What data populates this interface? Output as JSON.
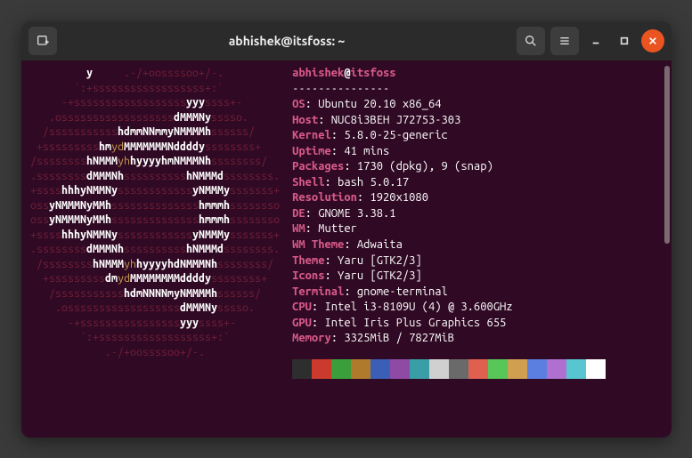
{
  "title": "abhishek@itsfoss: ~",
  "userhost": {
    "user": "abhishek",
    "at": "@",
    "host": "itsfoss"
  },
  "dashes": "---------------",
  "info": [
    {
      "k": "OS",
      "v": "Ubuntu 20.10 x86_64"
    },
    {
      "k": "Host",
      "v": "NUC8i3BEH J72753-303"
    },
    {
      "k": "Kernel",
      "v": "5.8.0-25-generic"
    },
    {
      "k": "Uptime",
      "v": "41 mins"
    },
    {
      "k": "Packages",
      "v": "1730 (dpkg), 9 (snap)"
    },
    {
      "k": "Shell",
      "v": "bash 5.0.17"
    },
    {
      "k": "Resolution",
      "v": "1920x1080"
    },
    {
      "k": "DE",
      "v": "GNOME 3.38.1"
    },
    {
      "k": "WM",
      "v": "Mutter"
    },
    {
      "k": "WM Theme",
      "v": "Adwaita"
    },
    {
      "k": "Theme",
      "v": "Yaru [GTK2/3]"
    },
    {
      "k": "Icons",
      "v": "Yaru [GTK2/3]"
    },
    {
      "k": "Terminal",
      "v": "gnome-terminal"
    },
    {
      "k": "CPU",
      "v": "Intel i3-8109U (4) @ 3.600GHz"
    },
    {
      "k": "GPU",
      "v": "Intel Iris Plus Graphics 655"
    },
    {
      "k": "Memory",
      "v": "3325MiB / 7827MiB"
    }
  ],
  "palette": [
    "#2e2e2e",
    "#cc3a2d",
    "#3a9e3a",
    "#b07a2c",
    "#3b5fb7",
    "#8f4aa6",
    "#3a9ea6",
    "#d0d0d0",
    "#6a6a6a",
    "#e06050",
    "#58c658",
    "#d0a050",
    "#5a7fe0",
    "#b070d0",
    "#58c6d0",
    "#ffffff"
  ],
  "ascii": [
    [
      [
        "s",
        "         "
      ],
      [
        "w",
        "y"
      ],
      [
        "s",
        "     .-/+oossssoo+/-."
      ]
    ],
    [
      [
        "s",
        "       `:+ssssssssssssssssss+:`"
      ]
    ],
    [
      [
        "s",
        "     -+ssssssssssssssssss"
      ],
      [
        "w",
        "yyy"
      ],
      [
        "s",
        "ssss+-"
      ]
    ],
    [
      [
        "s",
        "   .ossssssssssssssssss"
      ],
      [
        "w",
        "dMMMNy"
      ],
      [
        "s",
        "sssso."
      ]
    ],
    [
      [
        "s",
        "  /sssssssssss"
      ],
      [
        "w",
        "hdmmNNmmyNMMMMh"
      ],
      [
        "s",
        "ssssss/"
      ]
    ],
    [
      [
        "s",
        " +sssssssss"
      ],
      [
        "w",
        "hm"
      ],
      [
        "y",
        "yd"
      ],
      [
        "w",
        "MMMMMMMNddddy"
      ],
      [
        "s",
        "ssssssss+"
      ]
    ],
    [
      [
        "s",
        "/ssssssss"
      ],
      [
        "w",
        "hNMMM"
      ],
      [
        "y",
        "yh"
      ],
      [
        "w",
        "hyyyyhmNMMMNh"
      ],
      [
        "s",
        "ssssssss/"
      ]
    ],
    [
      [
        "s",
        ".ssssssss"
      ],
      [
        "w",
        "dMMMNh"
      ],
      [
        "s",
        "ssssssssss"
      ],
      [
        "w",
        "hNMMMd"
      ],
      [
        "s",
        "ssssssss."
      ]
    ],
    [
      [
        "s",
        "+ssss"
      ],
      [
        "w",
        "hhhyNMMNy"
      ],
      [
        "s",
        "ssssssssssss"
      ],
      [
        "w",
        "yNMMMy"
      ],
      [
        "s",
        "sssssss+"
      ]
    ],
    [
      [
        "s",
        "oss"
      ],
      [
        "w",
        "yNMMMNyMMh"
      ],
      [
        "s",
        "ssssssssssssss"
      ],
      [
        "w",
        "hmmmh"
      ],
      [
        "s",
        "ssssssso"
      ]
    ],
    [
      [
        "s",
        "oss"
      ],
      [
        "w",
        "yNMMMNyMMh"
      ],
      [
        "s",
        "ssssssssssssss"
      ],
      [
        "w",
        "hmmmh"
      ],
      [
        "s",
        "ssssssso"
      ]
    ],
    [
      [
        "s",
        "+ssss"
      ],
      [
        "w",
        "hhhyNMMNy"
      ],
      [
        "s",
        "ssssssssssss"
      ],
      [
        "w",
        "yNMMMy"
      ],
      [
        "s",
        "sssssss+"
      ]
    ],
    [
      [
        "s",
        ".ssssssss"
      ],
      [
        "w",
        "dMMMNh"
      ],
      [
        "s",
        "ssssssssss"
      ],
      [
        "w",
        "hNMMMd"
      ],
      [
        "s",
        "ssssssss."
      ]
    ],
    [
      [
        "s",
        " /ssssssss"
      ],
      [
        "w",
        "hNMMM"
      ],
      [
        "y",
        "yh"
      ],
      [
        "w",
        "hyyyyhdNMMMNh"
      ],
      [
        "s",
        "ssssssss/"
      ]
    ],
    [
      [
        "s",
        "  +sssssssss"
      ],
      [
        "w",
        "dm"
      ],
      [
        "y",
        "yd"
      ],
      [
        "w",
        "MMMMMMMMddddy"
      ],
      [
        "s",
        "ssssssss+"
      ]
    ],
    [
      [
        "s",
        "   /sssssssssss"
      ],
      [
        "w",
        "hdmNNNNmyNMMMMh"
      ],
      [
        "s",
        "ssssss/"
      ]
    ],
    [
      [
        "s",
        "    .ossssssssssssssssss"
      ],
      [
        "w",
        "dMMMNy"
      ],
      [
        "s",
        "sssso."
      ]
    ],
    [
      [
        "s",
        "      -+ssssssssssssssss"
      ],
      [
        "w",
        "yyy"
      ],
      [
        "s",
        "ssss+-"
      ]
    ],
    [
      [
        "s",
        "        `:+ssssssssssssssssss+:`"
      ]
    ],
    [
      [
        "s",
        "            .-/+oossssoo+/-."
      ]
    ]
  ]
}
